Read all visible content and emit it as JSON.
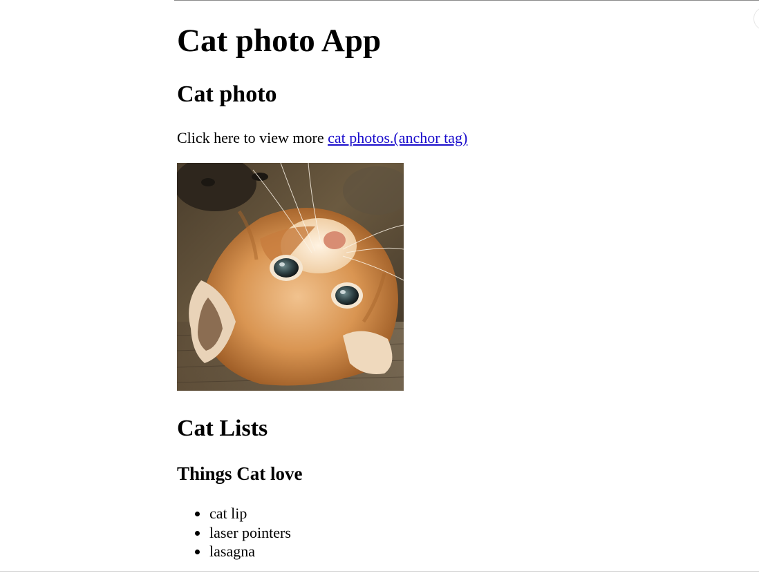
{
  "page": {
    "title": "Cat photo App"
  },
  "photo_section": {
    "heading": "Cat photo",
    "intro_prefix": "Click here to view more ",
    "link_text": "cat photos.(anchor tag)"
  },
  "lists_section": {
    "heading": "Cat Lists",
    "subheading": "Things Cat love",
    "items": [
      "cat lip",
      "laser pointers",
      "lasagna"
    ]
  },
  "colors": {
    "link": "#1a0dcc",
    "text": "#000000",
    "background": "#ffffff"
  }
}
